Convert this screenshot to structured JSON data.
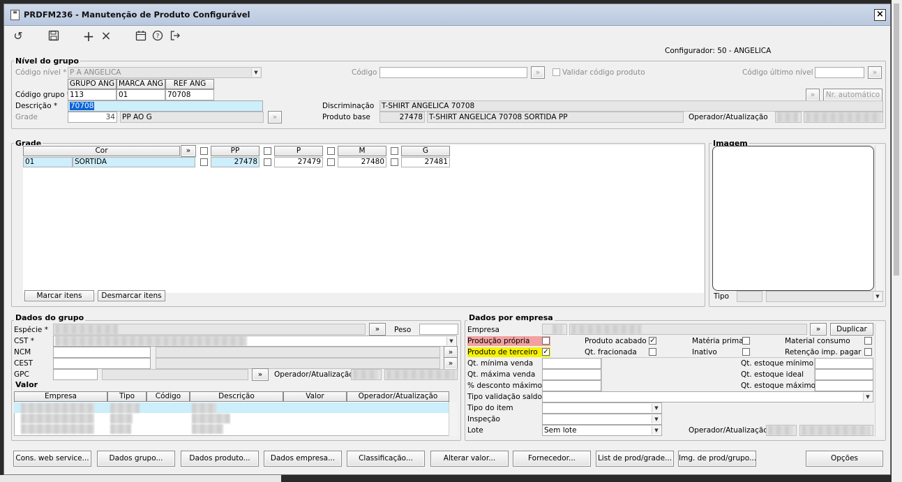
{
  "window": {
    "title": "PRDFM236 - Manutenção de Produto Configurável",
    "close": "×"
  },
  "toolbar": {
    "undo": "↺",
    "save": "💾",
    "add": "+",
    "remove": "×",
    "calendar": "▦",
    "help": "?",
    "exit": "⇥"
  },
  "configurador": "Configurador: 50 - ANGELICA",
  "nivel": {
    "title": "Nível do grupo",
    "codigo_nivel_label": "Código nível *",
    "codigo_nivel_value": "P A ANGELICA",
    "codigo_label": "Código",
    "codigo_value": "",
    "validar_label": "Validar código produto",
    "codigo_ultimo_label": "Código último nível",
    "codigo_ultimo_value": "",
    "headers": [
      "GRUPO ANG",
      "MARCA ANG",
      "REF ANG"
    ],
    "codigo_grupo_label": "Código grupo *",
    "grupo_values": [
      "113",
      "01",
      "70708"
    ],
    "nr_automatico": "Nr. automático",
    "descricao_label": "Descrição *",
    "descricao_value": "70708",
    "discriminacao_label": "Discriminação",
    "discriminacao_value": "T-SHIRT ANGELICA 70708",
    "grade_label": "Grade",
    "grade_num": "34",
    "grade_text": "PP AO G",
    "produto_base_label": "Produto base",
    "produto_base_num": "27478",
    "produto_base_text": "T-SHIRT ANGELICA 70708 SORTIDA PP",
    "operador_label": "Operador/Atualização"
  },
  "grade": {
    "title": "Grade",
    "col_cor": "Cor",
    "sizes": [
      "PP",
      "P",
      "M",
      "G"
    ],
    "row": {
      "code": "01",
      "name": "SORTIDA",
      "values": [
        "27478",
        "27479",
        "27480",
        "27481"
      ]
    },
    "marcar": "Marcar itens",
    "desmarcar": "Desmarcar itens"
  },
  "imagem": {
    "title": "Imagem",
    "tipo_label": "Tipo"
  },
  "dados_grupo": {
    "title": "Dados do grupo",
    "especie_label": "Espécie *",
    "peso_label": "Peso",
    "cst_label": "CST *",
    "ncm_label": "NCM",
    "cest_label": "CEST",
    "gpc_label": "GPC",
    "operador_label": "Operador/Atualização"
  },
  "valor": {
    "title": "Valor",
    "headers": [
      "Empresa",
      "Tipo",
      "Código",
      "Descrição",
      "Valor",
      "Operador/Atualização"
    ]
  },
  "dados_empresa": {
    "title": "Dados por empresa",
    "empresa_label": "Empresa",
    "duplicar": "Duplicar",
    "producao_propria": "Produção própria",
    "produto_terceiro": "Produto de terceiro",
    "produto_acabado": "Produto acabado",
    "qt_fracionada": "Qt. fracionada",
    "materia_prima": "Matéria prima",
    "inativo": "Inativo",
    "material_consumo": "Material consumo",
    "retencao": "Retenção imp. pagar",
    "qt_min_venda": "Qt. mínima venda",
    "qt_max_venda": "Qt. máxima venda",
    "desconto_max": "% desconto máximo",
    "qt_estoque_min": "Qt. estoque mínimo",
    "qt_estoque_ideal": "Qt. estoque ideal",
    "qt_estoque_max": "Qt. estoque máximo",
    "tipo_validacao": "Tipo validação saldo",
    "tipo_item": "Tipo do item",
    "inspecao": "Inspeção",
    "lote_label": "Lote",
    "lote_value": "Sem lote",
    "operador_label": "Operador/Atualização",
    "check_mark": "✓"
  },
  "footer": [
    "Cons. web service...",
    "Dados grupo...",
    "Dados produto...",
    "Dados empresa...",
    "Classificação...",
    "Alterar valor...",
    "Fornecedor...",
    "List de prod/grade...",
    "Img. de prod/grupo...",
    "Opções"
  ],
  "colors": {
    "titlebar": "#b9c8df",
    "selection": "#9fe0f7",
    "row_highlight": "#cdeefb",
    "pink": "#f2a0a0",
    "yellow": "#f7f200"
  }
}
